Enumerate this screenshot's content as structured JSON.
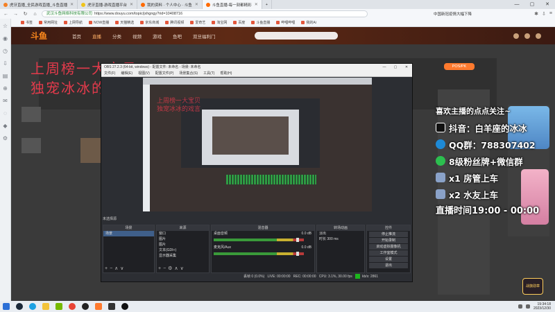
{
  "browser": {
    "tabs": [
      {
        "label": "虎牙直播_全民游戏直播_斗鱼直播",
        "color": "#f48024"
      },
      {
        "label": "虎牙直播-游戏直播平台",
        "color": "#f0c419"
      },
      {
        "label": "我的资料 · 个人中心 · 斗鱼",
        "color": "#ff6a00"
      },
      {
        "label": "斗鱼直播-每一刻都精彩",
        "color": "#ff6a00"
      }
    ],
    "url_site": "武汉斗鱼网络科技有限公司",
    "url": "https://www.douyu.com/topic/jxhgngy?rid=10408716",
    "news_hint": "中国新冠疫情大幅下降",
    "bookmarks": [
      "书签",
      "常用网址",
      "上网导航",
      "NOW直播",
      "天猫精选",
      "京东商城",
      "腾讯视频",
      "爱奇艺",
      "淘宝网",
      "百度",
      "斗鱼直播",
      "哔哩哔哩",
      "我的Ai"
    ],
    "window_controls": [
      "—",
      "▢",
      "✕"
    ]
  },
  "douyu": {
    "logo": "斗鱼",
    "nav": [
      "首页",
      "直播",
      "分类",
      "视频",
      "游戏",
      "鱼吧",
      "双旦福利门"
    ],
    "active_nav": "直播",
    "pos_button": "POS/PK",
    "overlay_title_lines": [
      "上周榜一大宝贝",
      "独宠冰冰的戏言"
    ],
    "badge": "战旗勋章"
  },
  "obs": {
    "title": "OBS 27.2.3 (64-bit, windows) - 配置文件: 未命名 - 场景: 未命名",
    "menu": [
      "文件(F)",
      "编辑(E)",
      "视图(V)",
      "配置文件(P)",
      "场景集合(S)",
      "工具(T)",
      "帮助(H)"
    ],
    "scene_label": "未选择源",
    "docks": {
      "scenes": {
        "title": "场景",
        "items": [
          "场景"
        ]
      },
      "sources": {
        "title": "来源",
        "items": [
          "窗口",
          "图片",
          "图片",
          "文本(GDI+)",
          "显示器采集"
        ]
      },
      "mixer": {
        "title": "混音器",
        "channels": [
          {
            "name": "桌面音频",
            "db": "0.0 dB"
          },
          {
            "name": "麦克风/Aux",
            "db": "0.0 dB"
          }
        ]
      },
      "transitions": {
        "title": "转场动画",
        "type": "淡出",
        "duration_label": "时长",
        "duration": "300 ms"
      },
      "controls": {
        "title": "控件",
        "buttons": [
          "停止推流",
          "开始录制",
          "启动虚拟摄像机",
          "工作室模式",
          "设置",
          "退出"
        ]
      }
    },
    "status": {
      "dropped": "丢帧 0 (0.0%)",
      "live": "LIVE: 00:00:00",
      "rec": "REC: 00:00:00",
      "cpu": "CPU: 3.1%, 30.00 fps",
      "kbps": "kb/s: 2861"
    }
  },
  "overlay": {
    "heading": "喜欢主播的点点关注~",
    "lines": [
      {
        "icon": "douyin-icon",
        "text": "抖音：白羊座的冰冰",
        "color": "#111111"
      },
      {
        "icon": "qq-icon",
        "text": "QQ群：788307402",
        "color": "#1e8ad6"
      },
      {
        "icon": "wechat-icon",
        "text": "8级粉丝牌+微信群",
        "color": "#2cbf4f"
      },
      {
        "icon": "car-icon",
        "text": "x1 房管上车",
        "color": "#8aa2c9"
      },
      {
        "icon": "car-icon",
        "text": "x2 水友上车",
        "color": "#8aa2c9"
      }
    ],
    "time": "直播时间19:00 - 00:00"
  },
  "taskbar": {
    "apps": [
      "windows-start",
      "steam",
      "edge",
      "file-explorer",
      "nvidia",
      "chrome",
      "qq",
      "douyu",
      "obs"
    ],
    "time": "19:34:18",
    "date": "2023/12/30"
  }
}
